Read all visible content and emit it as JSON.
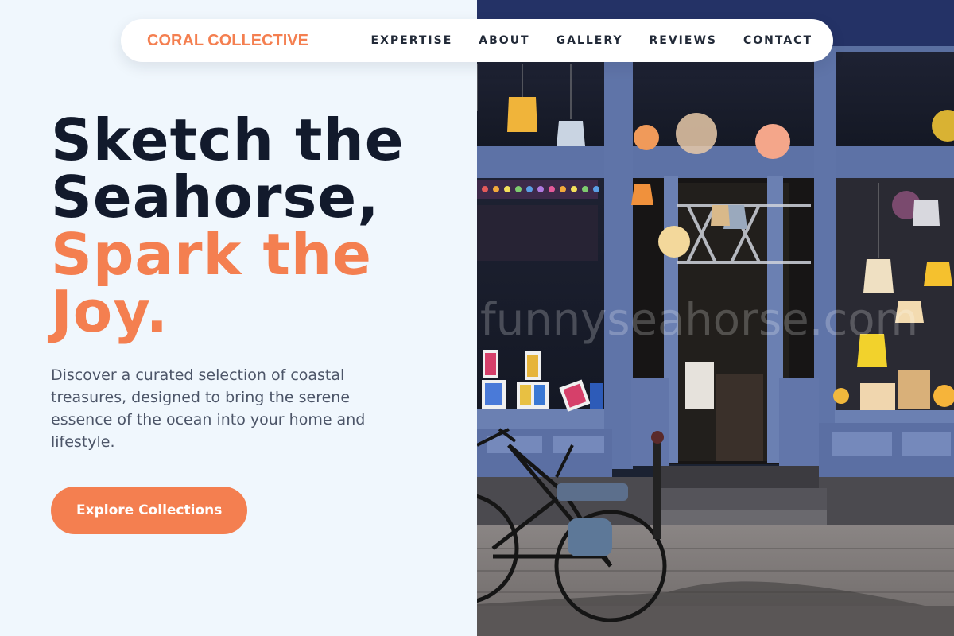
{
  "nav": {
    "brand": "CORAL COLLECTIVE",
    "links": [
      "EXPERTISE",
      "ABOUT",
      "GALLERY",
      "REVIEWS",
      "CONTACT"
    ]
  },
  "hero": {
    "headline_line1": "Sketch the",
    "headline_line2": "Seahorse,",
    "accent_line1": "Spark the",
    "accent_line2": "Joy.",
    "description": "Discover a curated selection of coastal treasures, designed to bring the serene essence of the ocean into your home and lifestyle.",
    "cta_label": "Explore Collections"
  },
  "photo": {
    "watermark": "funnyseahorse.com",
    "subject": "storefront-with-lamps-and-bicycle"
  },
  "colors": {
    "accent": "#f47f50",
    "heading": "#121a2c",
    "body_text": "#4c5568",
    "page_background": "#f0f7fd",
    "nav_background": "#ffffff"
  }
}
